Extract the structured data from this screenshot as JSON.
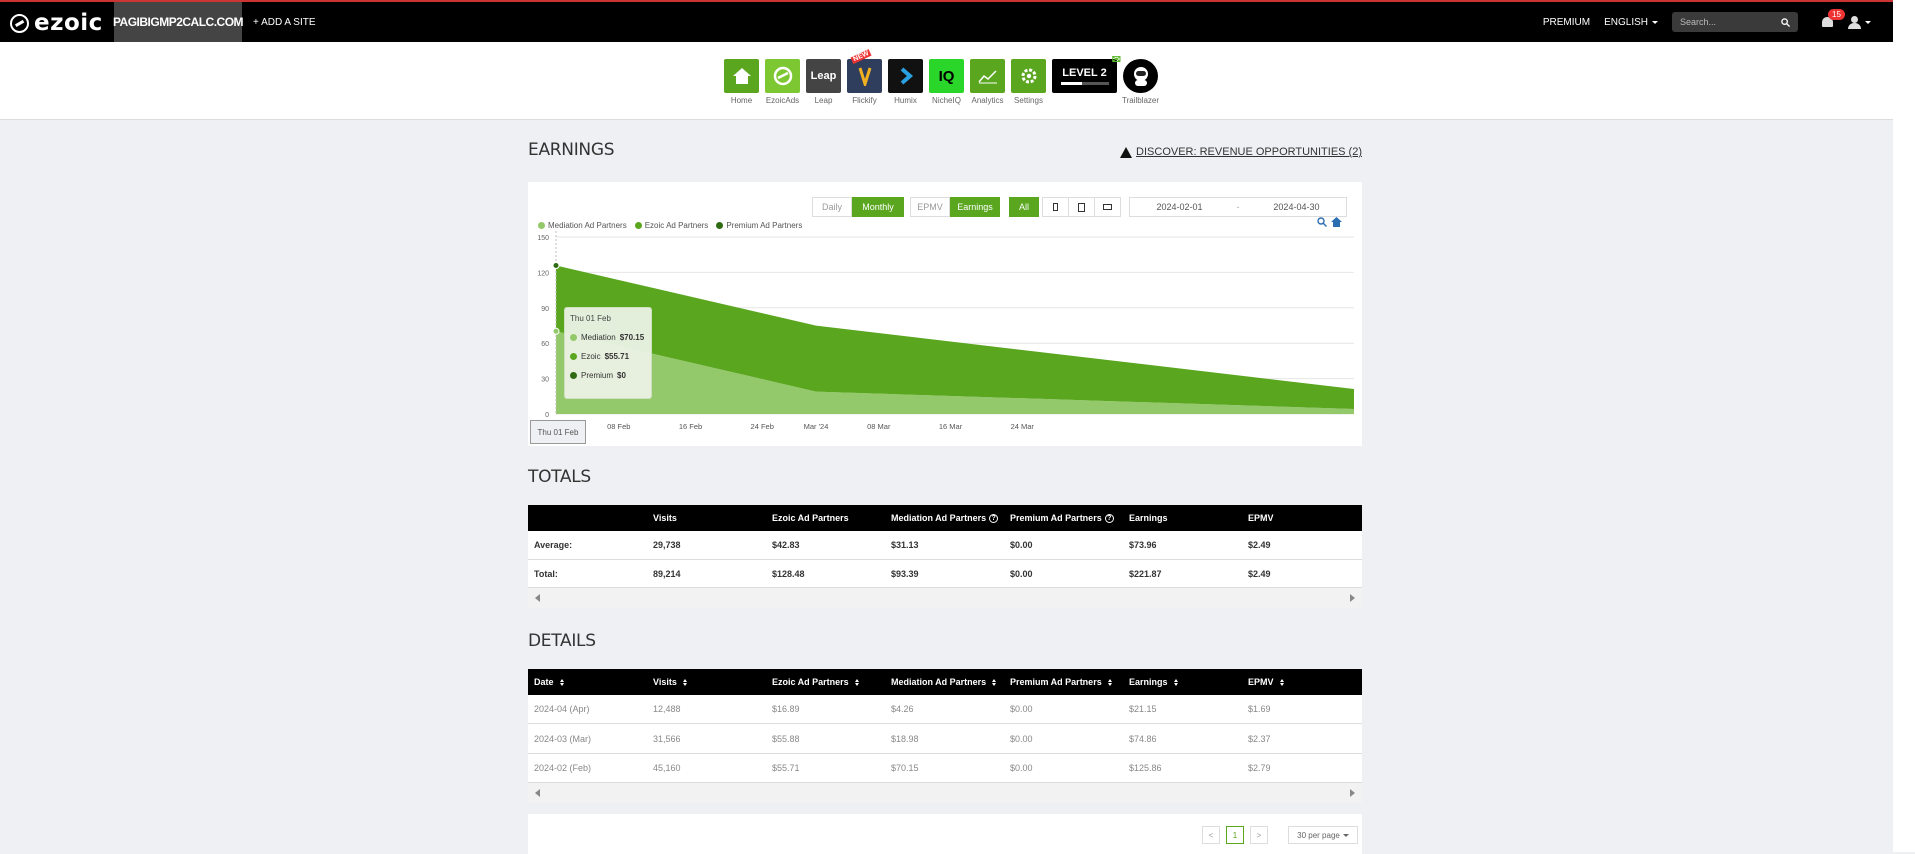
{
  "topbar": {
    "logo": "ezoic",
    "site": "PAGIBIGMP2CALC.COM",
    "add_site": "+ ADD A SITE",
    "premium": "PREMIUM",
    "language": "ENGLISH",
    "search_placeholder": "Search...",
    "notifications": "15"
  },
  "apps": [
    {
      "label": "Home",
      "color": "#5aa61f",
      "icon": "home-icon"
    },
    {
      "label": "EzoicAds",
      "color": "#7dc832",
      "icon": "ezoicads-icon"
    },
    {
      "label": "Leap",
      "color": "#444444",
      "icon": "leap-icon",
      "text": "Leap"
    },
    {
      "label": "Flickify",
      "color": "#2f3e5c",
      "icon": "flickify-icon"
    },
    {
      "label": "Humix",
      "color": "#111111",
      "icon": "humix-icon"
    },
    {
      "label": "NicheIQ",
      "color": "#2ad62a",
      "icon": "nicheiq-icon",
      "text": "IQ"
    },
    {
      "label": "Analytics",
      "color": "#5aa61f",
      "icon": "analytics-icon"
    },
    {
      "label": "Settings",
      "color": "#5aa61f",
      "icon": "gear-icon"
    }
  ],
  "new_badge": "NEW",
  "level": {
    "text": "LEVEL 2",
    "progress": 0.45
  },
  "trailblazer": "Trailblazer",
  "earnings": {
    "title": "EARNINGS",
    "discover": "DISCOVER: REVENUE OPPORTUNITIES (2)",
    "period_buttons": [
      "Daily",
      "Monthly"
    ],
    "period_active": "Monthly",
    "metric_buttons": [
      "EPMV",
      "Earnings"
    ],
    "metric_active": "Earnings",
    "device_all": "All",
    "date_from": "2024-02-01",
    "date_sep": "-",
    "date_to": "2024-04-30",
    "legend": [
      "Mediation Ad Partners",
      "Ezoic Ad Partners",
      "Premium Ad Partners"
    ],
    "tooltip": {
      "date": "Thu 01 Feb",
      "rows": [
        {
          "name": "Mediation",
          "value": "$70.15"
        },
        {
          "name": "Ezoic",
          "value": "$55.71"
        },
        {
          "name": "Premium",
          "value": "$0"
        }
      ]
    },
    "hover_label": "Thu 01 Feb"
  },
  "chart_data": {
    "type": "area",
    "stacked": true,
    "y_ticks": [
      "0",
      "30",
      "60",
      "90",
      "120",
      "150"
    ],
    "ylim": [
      0,
      150
    ],
    "x_ticks": [
      "08 Feb",
      "16 Feb",
      "24 Feb",
      "Mar '24",
      "08 Mar",
      "16 Mar",
      "24 Mar"
    ],
    "x": [
      "2024-02-01",
      "2024-03-01",
      "2024-04-30"
    ],
    "series": [
      {
        "name": "Mediation Ad Partners",
        "color": "#93c96a",
        "values": [
          70.15,
          18.98,
          4.26
        ]
      },
      {
        "name": "Ezoic Ad Partners",
        "color": "#5aa61f",
        "values": [
          55.71,
          55.88,
          16.89
        ]
      },
      {
        "name": "Premium Ad Partners",
        "color": "#2e6b12",
        "values": [
          0,
          0,
          0
        ]
      }
    ]
  },
  "totals": {
    "title": "TOTALS",
    "headers": [
      "",
      "Visits",
      "Ezoic Ad Partners",
      "Mediation Ad Partners",
      "Premium Ad Partners",
      "Earnings",
      "EPMV"
    ],
    "rows": [
      [
        "Average:",
        "29,738",
        "$42.83",
        "$31.13",
        "$0.00",
        "$73.96",
        "$2.49"
      ],
      [
        "Total:",
        "89,214",
        "$128.48",
        "$93.39",
        "$0.00",
        "$221.87",
        "$2.49"
      ]
    ]
  },
  "details": {
    "title": "DETAILS",
    "headers": [
      "Date",
      "Visits",
      "Ezoic Ad Partners",
      "Mediation Ad Partners",
      "Premium Ad Partners",
      "Earnings",
      "EPMV"
    ],
    "rows": [
      [
        "2024-04 (Apr)",
        "12,488",
        "$16.89",
        "$4.26",
        "$0.00",
        "$21.15",
        "$1.69"
      ],
      [
        "2024-03 (Mar)",
        "31,566",
        "$55.88",
        "$18.98",
        "$0.00",
        "$74.86",
        "$2.37"
      ],
      [
        "2024-02 (Feb)",
        "45,160",
        "$55.71",
        "$70.15",
        "$0.00",
        "$125.86",
        "$2.79"
      ]
    ],
    "page": "1",
    "prev": "<",
    "next": ">",
    "per_page": "30 per page"
  }
}
